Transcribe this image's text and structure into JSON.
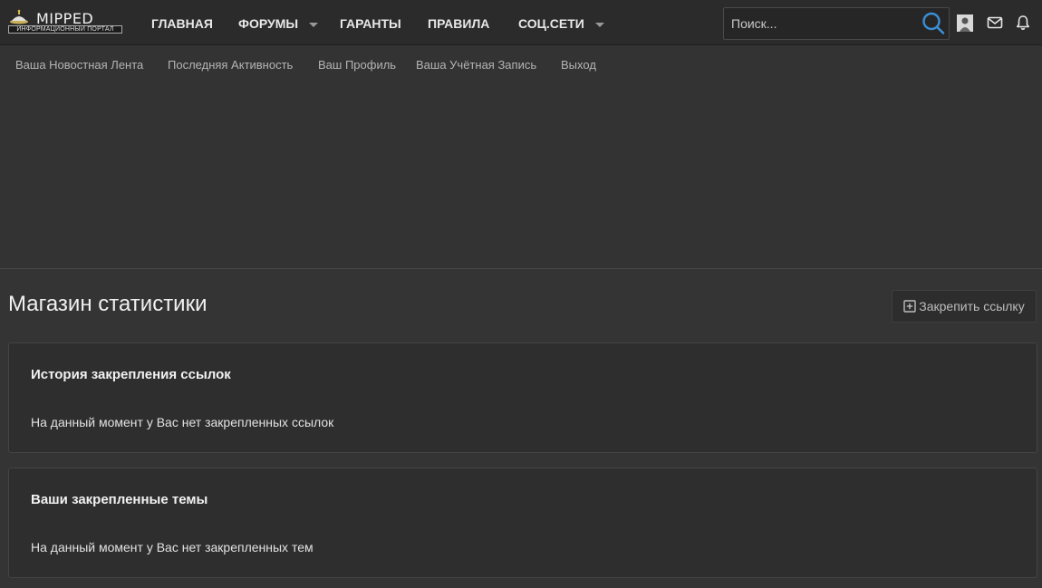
{
  "logo": {
    "word": "MIPPED",
    "tagline": "ИНФОРМАЦИОННЫЙ ПОРТАЛ"
  },
  "nav": [
    {
      "label": "ГЛАВНАЯ"
    },
    {
      "label": "ФОРУМЫ"
    },
    {
      "label": "ГАРАНТЫ"
    },
    {
      "label": "ПРАВИЛА"
    },
    {
      "label": "СОЦ.СЕТИ"
    }
  ],
  "search": {
    "placeholder": "Поиск...",
    "value": ""
  },
  "subnav": [
    "Ваша Новостная Лента",
    "Последняя Активность",
    "Ваш Профиль",
    "Ваша Учётная Запись",
    "Выход"
  ],
  "page": {
    "title": "Магазин статистики",
    "pin_button": "Закрепить ссылку"
  },
  "blocks": [
    {
      "title": "История закрепления ссылок",
      "text": "На данный момент у Вас нет закрепленных ссылок"
    },
    {
      "title": "Ваши закрепленные темы",
      "text": "На данный момент у Вас нет закрепленных тем"
    }
  ],
  "colors": {
    "accent": "#3a8fd6",
    "background": "#343434",
    "topbar": "#2b2b2b"
  }
}
